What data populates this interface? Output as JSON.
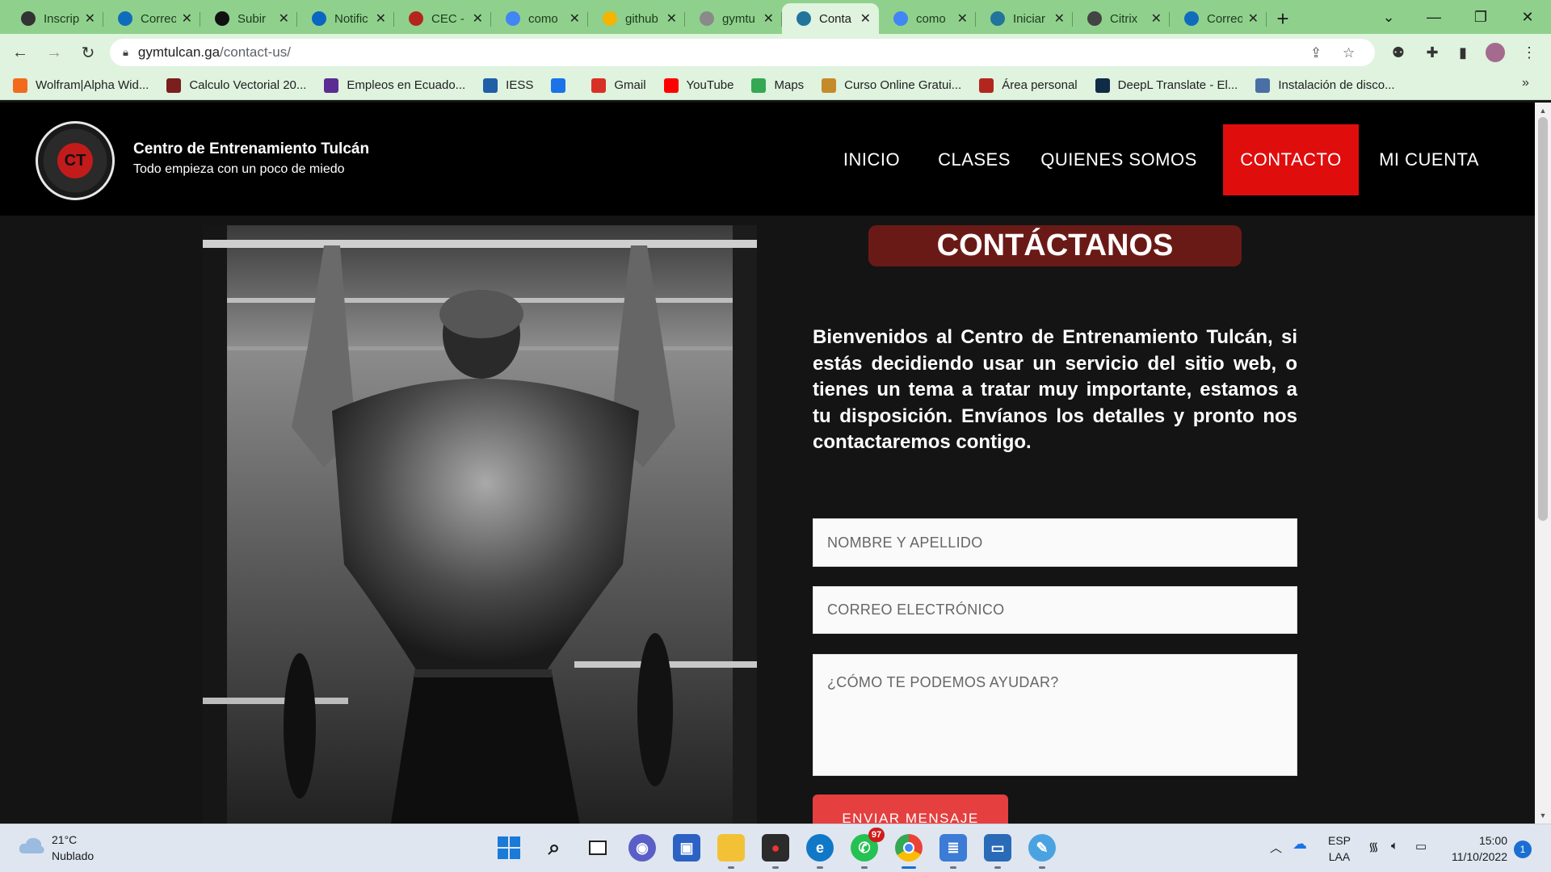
{
  "browser": {
    "tabs": [
      {
        "title": "Inscrip",
        "icon": "globe-icon",
        "color": "#333333",
        "active": false
      },
      {
        "title": "Correo",
        "icon": "outlook-icon",
        "color": "#0f6cbd",
        "active": false
      },
      {
        "title": "Subir",
        "icon": "github-icon",
        "color": "#111111",
        "active": false
      },
      {
        "title": "Notific",
        "icon": "linkedin-icon",
        "color": "#0a66c2",
        "active": false
      },
      {
        "title": "CEC -",
        "icon": "page-icon",
        "color": "#b3261e",
        "active": false
      },
      {
        "title": "como",
        "icon": "google-icon",
        "color": "#4285f4",
        "active": false
      },
      {
        "title": "github",
        "icon": "slides-icon",
        "color": "#f4b400",
        "active": false
      },
      {
        "title": "gymtu",
        "icon": "globe-icon",
        "color": "#8a8a8a",
        "active": false
      },
      {
        "title": "Conta",
        "icon": "wordpress-icon",
        "color": "#21759b",
        "active": true
      },
      {
        "title": "como",
        "icon": "google-icon",
        "color": "#4285f4",
        "active": false
      },
      {
        "title": "Iniciar",
        "icon": "wordpress-icon",
        "color": "#21759b",
        "active": false
      },
      {
        "title": "Citrix",
        "icon": "citrix-icon",
        "color": "#444444",
        "active": false
      },
      {
        "title": "Correo",
        "icon": "outlook-icon",
        "color": "#0f6cbd",
        "active": false
      }
    ],
    "url_host": "gymtulcan.ga",
    "url_path": "/contact-us/",
    "bookmarks": [
      {
        "label": "Wolfram|Alpha Wid...",
        "icon": "wolfram-icon",
        "color": "#f26b1d"
      },
      {
        "label": "Calculo Vectorial 20...",
        "icon": "book-icon",
        "color": "#7a1e1e"
      },
      {
        "label": "Empleos en Ecuado...",
        "icon": "chevron-icon",
        "color": "#5b2c91"
      },
      {
        "label": "IESS",
        "icon": "iess-icon",
        "color": "#1f5fa8"
      },
      {
        "label": "",
        "icon": "appstore-icon",
        "color": "#1a73e8"
      },
      {
        "label": "Gmail",
        "icon": "gmail-icon",
        "color": "#d93025"
      },
      {
        "label": "YouTube",
        "icon": "youtube-icon",
        "color": "#ff0000"
      },
      {
        "label": "Maps",
        "icon": "maps-icon",
        "color": "#34a853"
      },
      {
        "label": "Curso Online Gratui...",
        "icon": "course-icon",
        "color": "#c58b2a"
      },
      {
        "label": "Área personal",
        "icon": "moodle-icon",
        "color": "#b3261e"
      },
      {
        "label": "DeepL Translate - El...",
        "icon": "deepl-icon",
        "color": "#0f2b46"
      },
      {
        "label": "Instalación de disco...",
        "icon": "disk-icon",
        "color": "#4a6fa5"
      }
    ]
  },
  "site": {
    "logo_text": "CT",
    "title": "Centro de Entrenamiento Tulcán",
    "tagline": "Todo empieza con un poco de miedo",
    "nav": [
      {
        "label": "INICIO",
        "active": false
      },
      {
        "label": "CLASES",
        "active": false
      },
      {
        "label": "QUIENES SOMOS",
        "active": false
      },
      {
        "label": "CONTACTO",
        "active": true
      },
      {
        "label": "MI CUENTA",
        "active": false
      }
    ],
    "heading": "CONTÁCTANOS",
    "intro": "Bienvenidos al Centro de Entrenamiento Tulcán, si estás decidiendo usar un servicio del sitio web, o tienes un tema a tratar muy importante, estamos a tu disposición. Envíanos los detalles y pronto nos contactaremos contigo.",
    "form": {
      "name_placeholder": "NOMBRE Y APELLIDO",
      "email_placeholder": "CORREO ELECTRÓNICO",
      "message_placeholder": "¿CÓMO TE PODEMOS AYUDAR?",
      "submit_label": "ENVIAR MENSAJE"
    },
    "colors": {
      "accent": "#e00d0d",
      "heading_bg": "#6a1a16",
      "button": "#e53f3f"
    }
  },
  "taskbar": {
    "weather_temp": "21°C",
    "weather_desc": "Nublado",
    "whatsapp_badge": "97",
    "lang_line1": "ESP",
    "lang_line2": "LAA",
    "time": "15:00",
    "date": "11/10/2022",
    "notifications": "1"
  }
}
